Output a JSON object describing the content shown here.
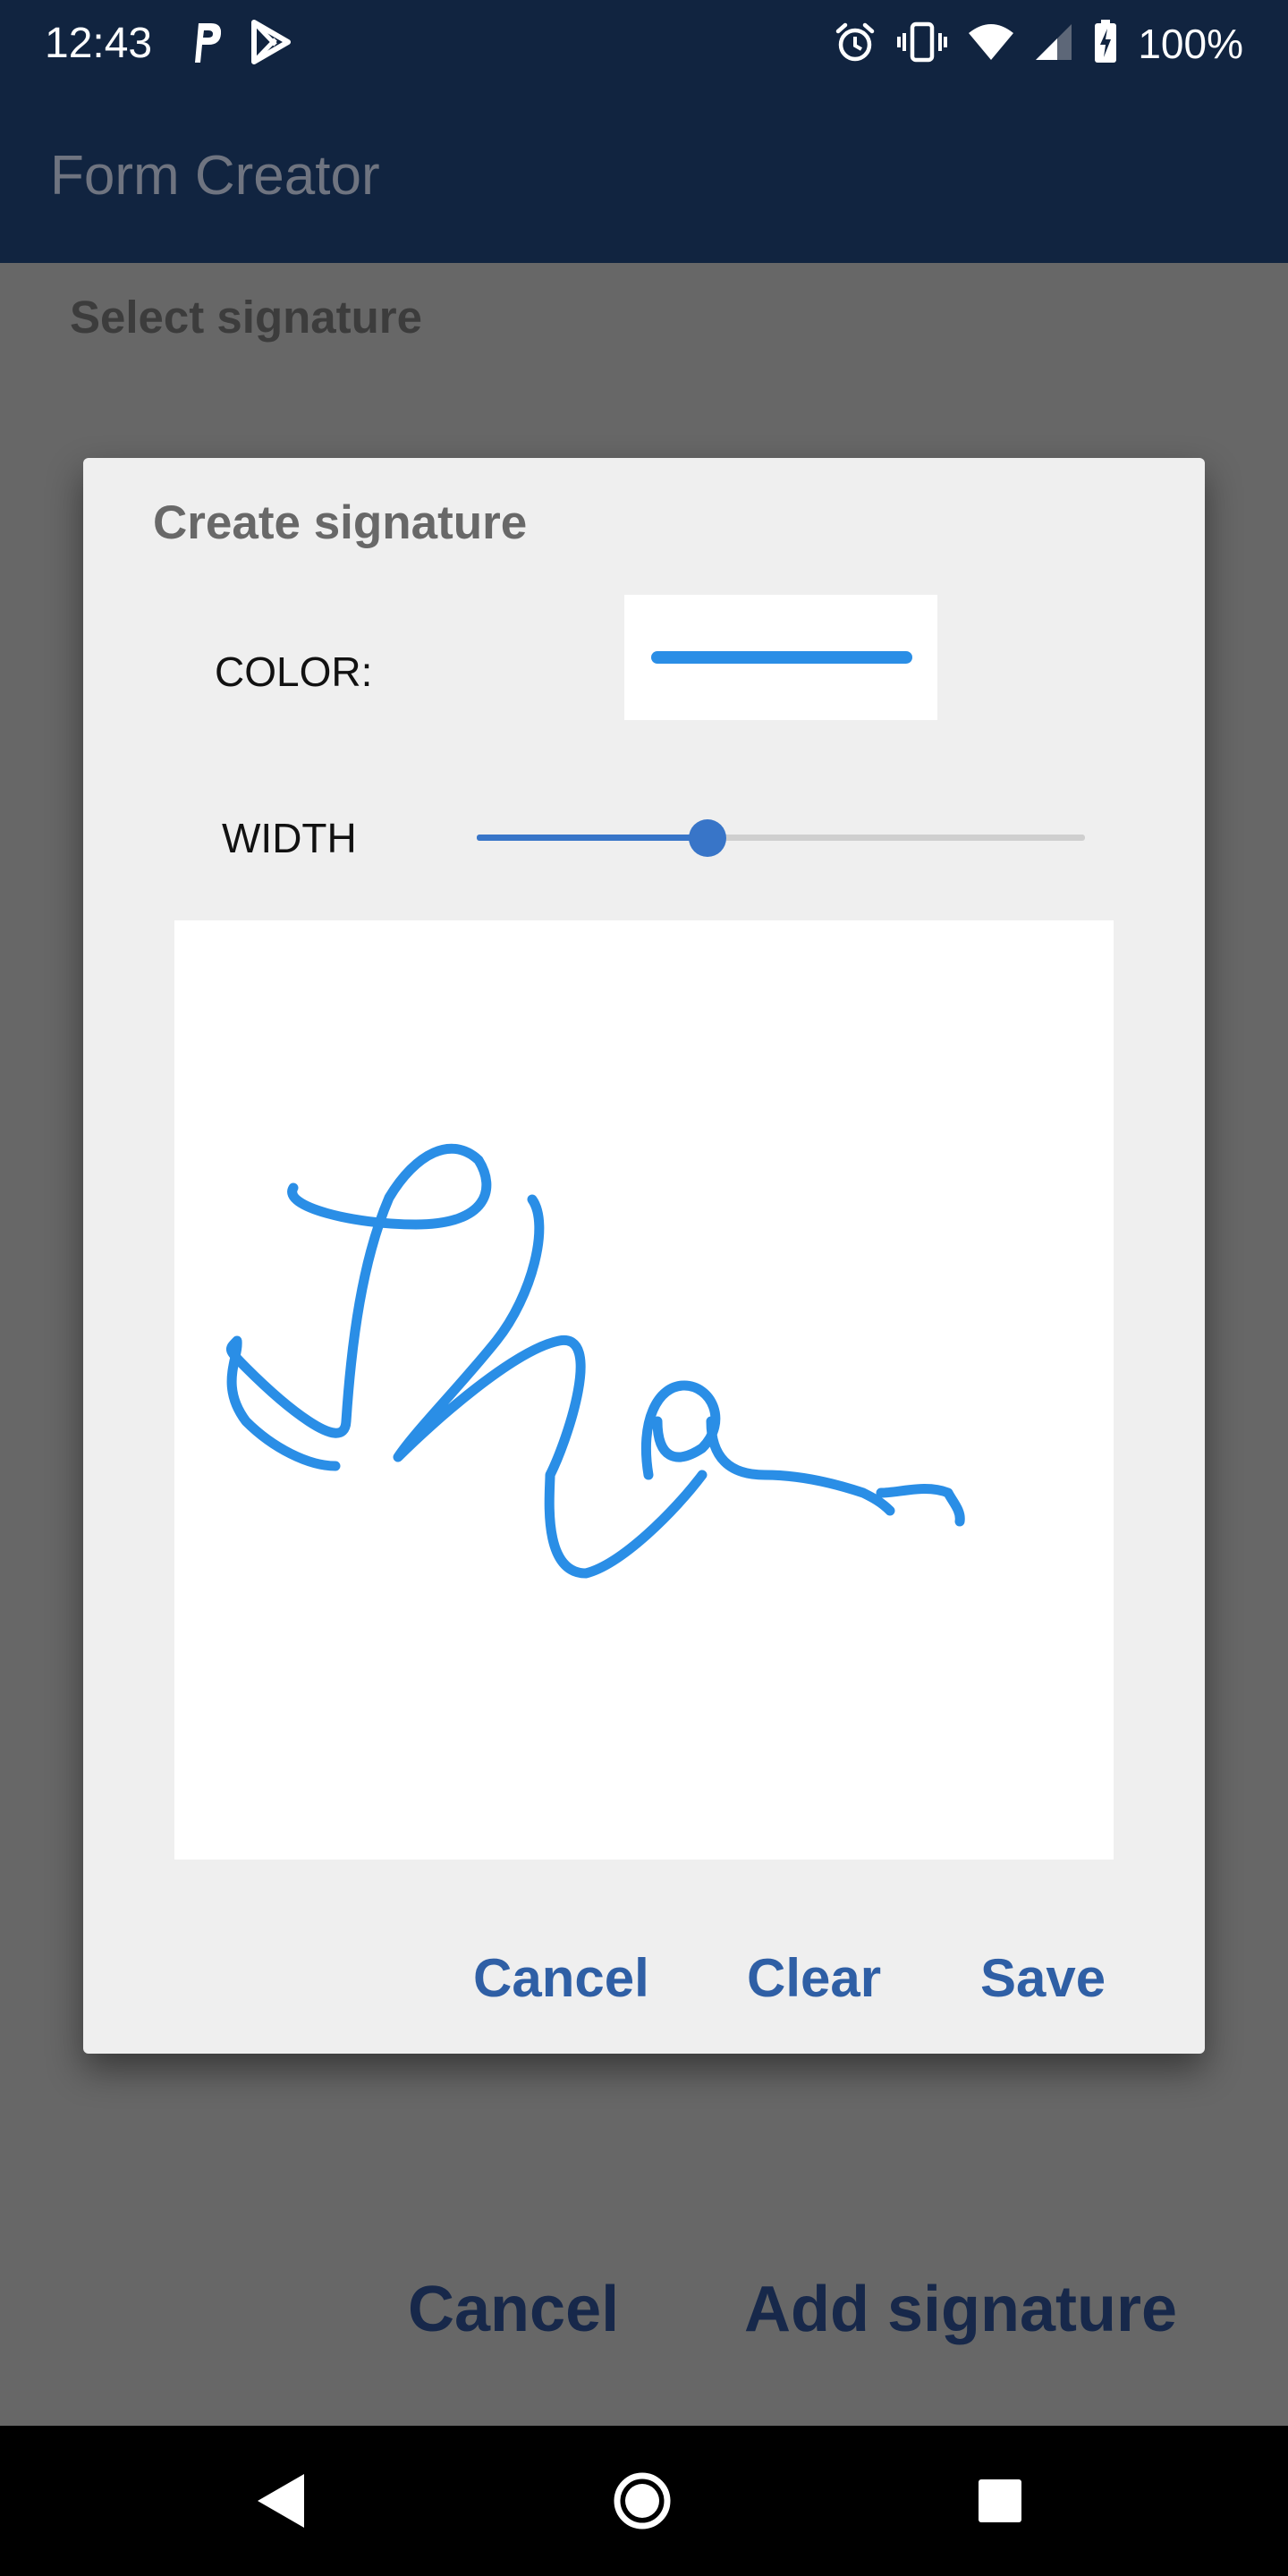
{
  "status_bar": {
    "time": "12:43",
    "battery_text": "100%",
    "left_icons": [
      "parking-icon",
      "play-store-icon"
    ],
    "right_icons": [
      "alarm-icon",
      "vibrate-icon",
      "wifi-icon",
      "cell-signal-icon",
      "battery-charging-icon"
    ]
  },
  "app_bar": {
    "title": "Form Creator"
  },
  "page": {
    "heading": "Select signature",
    "cancel_label": "Cancel",
    "add_label": "Add signature"
  },
  "dialog": {
    "title": "Create signature",
    "color_label": "COLOR:",
    "width_label": "WIDTH",
    "width_value": 0.38,
    "pen_color": "#2a8ee6",
    "cancel_label": "Cancel",
    "clear_label": "Clear",
    "save_label": "Save"
  },
  "nav_bar": {
    "icons": [
      "back-icon",
      "home-icon",
      "recents-icon"
    ]
  },
  "colors": {
    "app_bar": "#112440",
    "accent": "#3875c8",
    "dialog_button": "#2f5fa5",
    "page_button": "#17284a"
  }
}
